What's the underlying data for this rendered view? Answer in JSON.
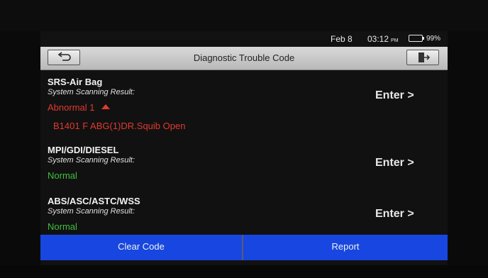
{
  "status": {
    "date": "Feb 8",
    "time": "03:12",
    "ampm": "PM",
    "battery": "99%",
    "battery_level": 0.99
  },
  "header": {
    "title": "Diagnostic Trouble Code",
    "back_icon": "back-arrow-icon",
    "exit_icon": "exit-door-icon"
  },
  "systems": [
    {
      "name": "SRS-Air Bag",
      "subtitle": "System Scanning Result:",
      "status": "Abnormal 1",
      "status_color": "#e03a2e",
      "fault": "B1401 F ABG(1)DR.Squib Open",
      "action": "Enter >"
    },
    {
      "name": "MPI/GDI/DIESEL",
      "subtitle": "System Scanning Result:",
      "status": "Normal",
      "status_color": "#3fbf3f",
      "action": "Enter >"
    },
    {
      "name": "ABS/ASC/ASTC/WSS",
      "subtitle": "System Scanning Result:",
      "status": "Normal",
      "status_color": "#3fbf3f",
      "action": "Enter >"
    }
  ],
  "footer": {
    "clear_label": "Clear Code",
    "report_label": "Report",
    "button_color": "#1747e0"
  }
}
